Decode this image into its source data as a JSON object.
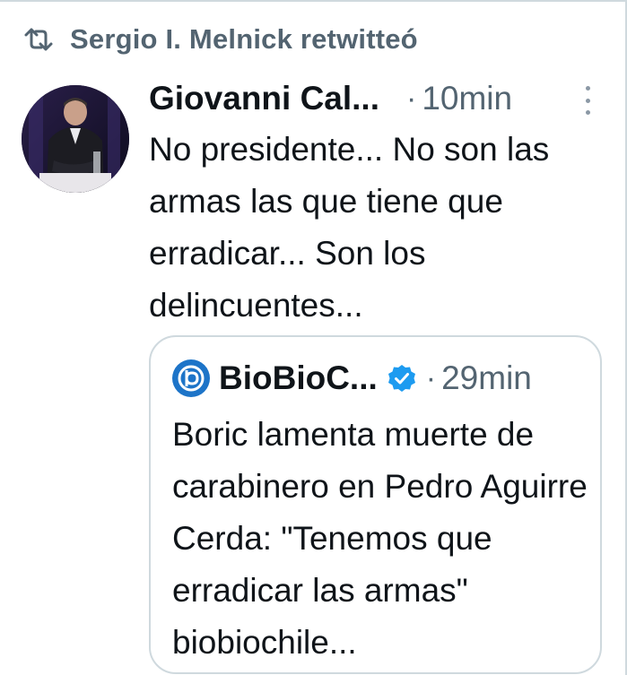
{
  "retweet": {
    "icon": "retweet-icon",
    "label": "Sergio I. Melnick retwitteó"
  },
  "tweet": {
    "author_display": "Giovanni Cal...",
    "separator": "·",
    "time": "10min",
    "more_icon": "more-vertical-icon",
    "text": "No presidente... No son las armas las que tiene que erradicar... Son los delincuentes..."
  },
  "quote": {
    "author_display": "BioBioC...",
    "verified_icon": "verified-badge-icon",
    "separator": "·",
    "time": "29min",
    "text": "Boric lamenta muerte de carabinero en Pedro Aguirre Cerda: \"Tenemos que erradicar las armas\"  biobiochile..."
  },
  "colors": {
    "primary_text": "#0f1419",
    "secondary_text": "#536471",
    "border": "#cfd9de",
    "verified_blue": "#1d9bf0",
    "brand_blue": "#1d74c8"
  }
}
